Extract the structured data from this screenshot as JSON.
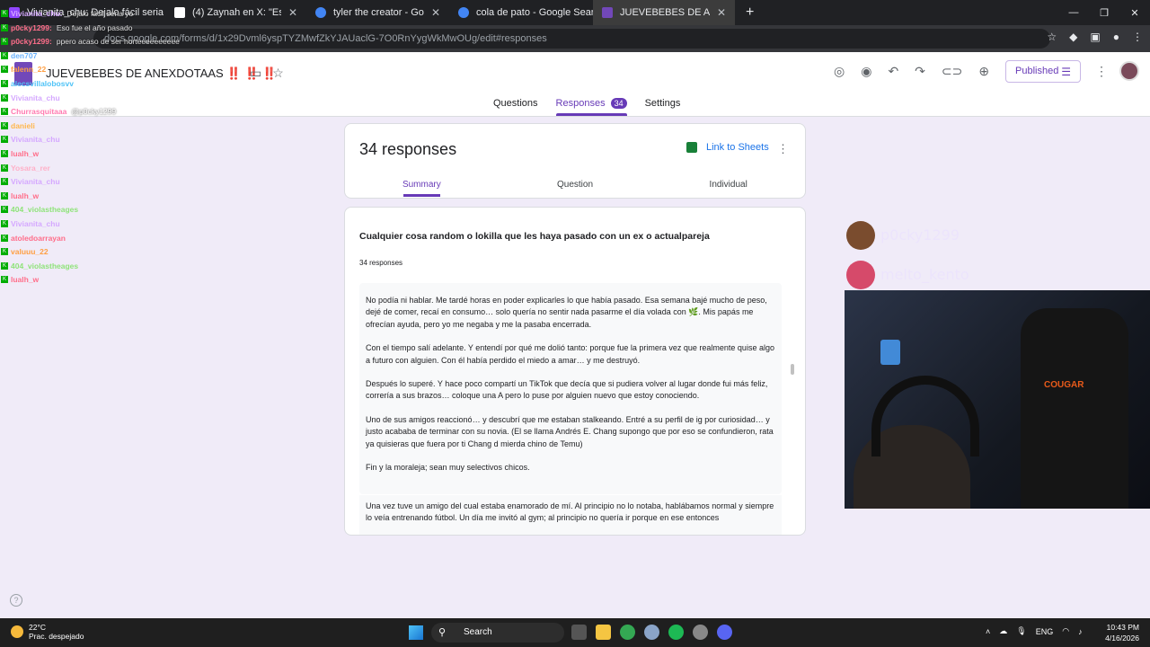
{
  "browser": {
    "tabs": [
      {
        "title": "Vivianita_chu: Dejalo fácil seria yo",
        "color": "#9146ff"
      },
      {
        "title": "(4) Zaynah en X: \"Esto confi",
        "color": "#ffffff"
      },
      {
        "title": "tyler the creator - Google Searc",
        "color": "#4285f4"
      },
      {
        "title": "cola de pato - Google Search",
        "color": "#4285f4"
      },
      {
        "title": "JUEVEBEBES DE ANEXDOTAAS",
        "color": "#7248b9"
      }
    ],
    "new_tab": "+",
    "url": "docs.google.com/forms/d/1x29Dvml6yspTYZMwfZkYJAUaclG-7O0RnYygWkMwOUg/edit#responses",
    "window_controls": [
      "—",
      "❐",
      "✕"
    ]
  },
  "forms": {
    "title": "JUEVEBEBES DE ANEXDOTAAS ‼️ ‼️ ‼️",
    "publish_label": "Published",
    "tabs": {
      "questions": "Questions",
      "responses": "Responses",
      "responses_count": "34",
      "settings": "Settings"
    }
  },
  "summary_card": {
    "count_label": "34 responses",
    "link_sheets": "Link to Sheets",
    "subtabs": {
      "summary": "Summary",
      "question": "Question",
      "individual": "Individual"
    }
  },
  "question_card": {
    "title": "Cualquier cosa random o lokilla que les haya pasado con un ex o actualpareja",
    "count": "34 responses",
    "response_paragraphs": [
      "No podía ni hablar. Me tardé horas en poder explicarles lo que había pasado. Esa semana bajé mucho de peso, dejé de comer, recaí en consumo… solo quería no sentir nada pasarme el día volada con 🌿. Mis papás me ofrecían ayuda, pero yo me negaba y me la pasaba encerrada.",
      "Con el tiempo salí adelante. Y entendí por qué me dolió tanto: porque fue la primera vez que realmente quise algo a futuro con alguien. Con él había perdido el miedo a amar… y me destruyó.",
      "Después lo superé. Y hace poco compartí un TikTok que decía que si pudiera volver al lugar donde fui más feliz, correría a sus brazos… coloque una A pero lo puse por alguien nuevo que estoy conociendo.",
      "Uno de sus amigos reaccionó… y descubrí que me estaban stalkeando. Entré a su perfil de ig por curiosidad… y justo acababa de terminar con su novia. (El se llama Andrés E. Chang supongo que por eso se confundieron, rata ya quisieras que fuera por ti Chang d mierda chino de Temu)",
      "Fin y la moraleja; sean muy selectivos chicos."
    ],
    "next_response": "Una vez tuve un amigo del cual estaba enamorado de mí. Al principio no lo notaba, hablábamos normal y siempre lo veía entrenando fútbol. Un día me invitó al gym; al principio no quería ir porque en ese entonces"
  },
  "chat": [
    {
      "user": "Vivianita_chu:",
      "msg": "Dejalo fácil seria yo",
      "color": "#d5a8ff"
    },
    {
      "user": "p0cky1299:",
      "msg": "Eso fue el año pasado",
      "color": "#ff6e8a"
    },
    {
      "user": "p0cky1299:",
      "msg": "ppero acaso de ser horteeeeeeeeee",
      "color": "#ff6e8a"
    },
    {
      "user": "den707",
      "msg": "",
      "color": "#6bb3ff"
    },
    {
      "user": "falenn_22",
      "msg": "",
      "color": "#ff9f43"
    },
    {
      "user": "alecsvillalobosvv",
      "msg": "",
      "color": "#4fc3f7"
    },
    {
      "user": "Vivianita_chu",
      "msg": "",
      "color": "#d5a8ff"
    },
    {
      "user": "Churrasquitaaa",
      "msg": "@p0cky1299",
      "color": "#ff7ab0"
    },
    {
      "user": "danieli",
      "msg": "",
      "color": "#ffb74d"
    },
    {
      "user": "Vivianita_chu",
      "msg": "",
      "color": "#d5a8ff"
    },
    {
      "user": "lualh_w",
      "msg": "",
      "color": "#ff6e8a"
    },
    {
      "user": "Yosara_rer",
      "msg": "",
      "color": "#ffb0c8"
    },
    {
      "user": "Vivianita_chu",
      "msg": "",
      "color": "#d5a8ff"
    },
    {
      "user": "lualh_w",
      "msg": "",
      "color": "#ff6e8a"
    },
    {
      "user": "404_violastheages",
      "msg": "",
      "color": "#8fe37a"
    },
    {
      "user": "Vivianita_chu",
      "msg": "",
      "color": "#d5a8ff"
    },
    {
      "user": "atoledoarrayan",
      "msg": "",
      "color": "#ff6e8a"
    },
    {
      "user": "valuuu_22",
      "msg": "",
      "color": "#ff9f43"
    },
    {
      "user": "404_violastheages",
      "msg": "",
      "color": "#8fe37a"
    },
    {
      "user": "lualh_w",
      "msg": "",
      "color": "#ff6e8a"
    }
  ],
  "overlay_names": [
    "p0cky1299",
    "melto_kento"
  ],
  "webcam": {
    "chair_logo": "COUGAR"
  },
  "taskbar": {
    "temp": "22°C",
    "weather": "Prac. despejado",
    "search": "Search",
    "lang": "ENG",
    "time": "10:43 PM",
    "date": "4/16/2026"
  },
  "help": "?"
}
